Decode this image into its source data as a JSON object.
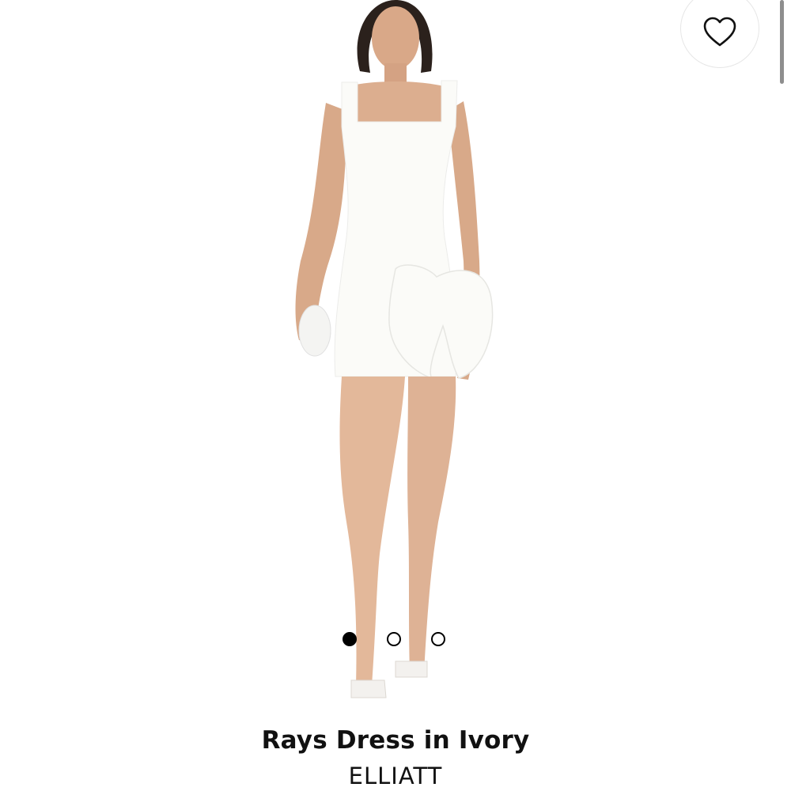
{
  "product": {
    "title": "Rays Dress in Ivory",
    "brand": "ELLIATT",
    "image_icon": "product-photo"
  },
  "favorite": {
    "icon": "heart-outline-icon"
  },
  "carousel": {
    "total": 3,
    "active_index": 1
  },
  "colors": {
    "dot_active": "#000000",
    "text": "#111111",
    "scrollbar": "#8e8e8e"
  }
}
